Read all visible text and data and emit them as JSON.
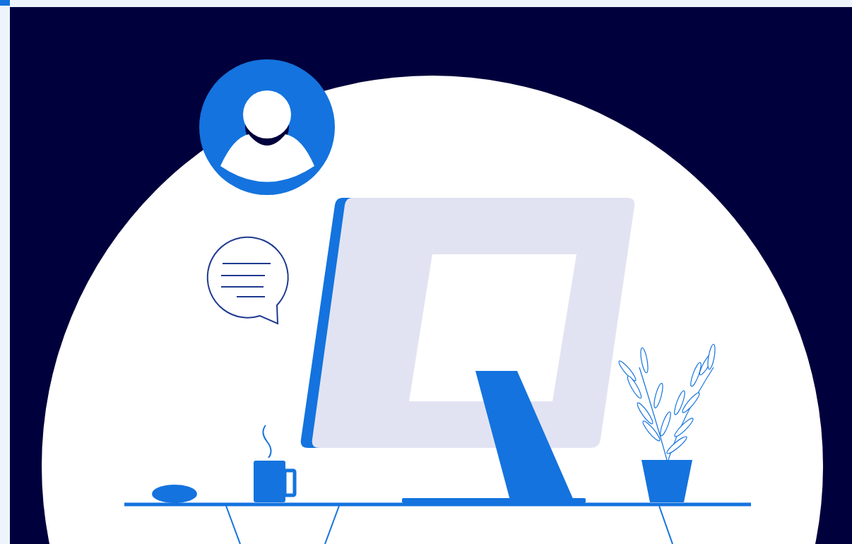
{
  "hero": {
    "kind": "workspace-illustration"
  }
}
